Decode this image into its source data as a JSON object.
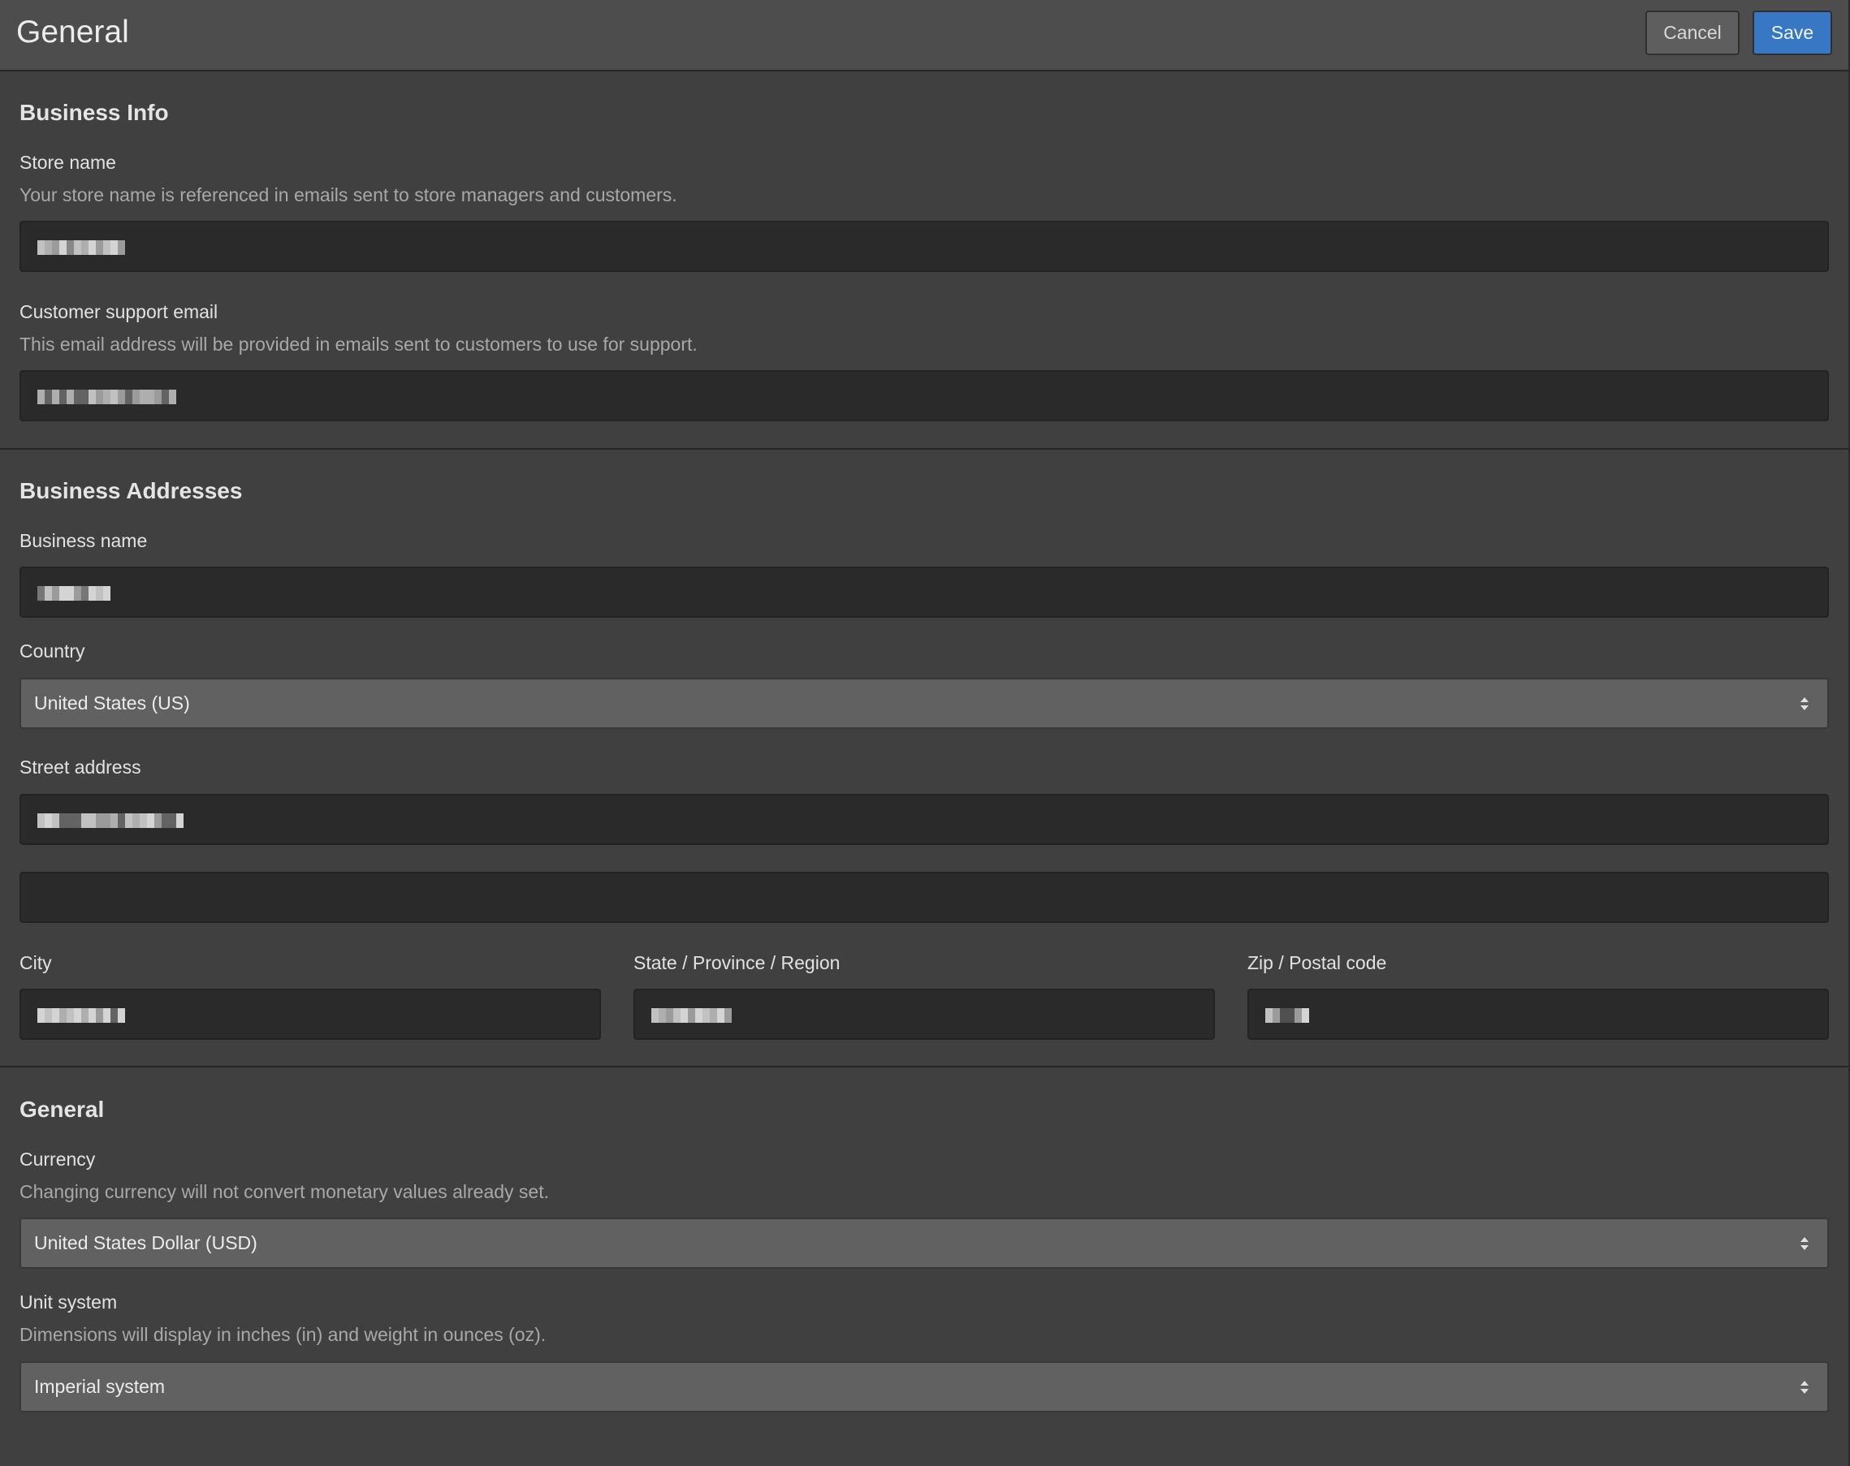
{
  "header": {
    "title": "General",
    "cancel_label": "Cancel",
    "save_label": "Save"
  },
  "colors": {
    "background": "#404040",
    "header_background": "#4d4d4d",
    "input_background": "#2a2a2a",
    "select_background": "#616161",
    "primary_button": "#3877c4",
    "secondary_button": "#5e5e5e"
  },
  "business_info": {
    "heading": "Business Info",
    "store_name": {
      "label": "Store name",
      "helper": "Your store name is referenced in emails sent to store managers and customers.",
      "value_redacted": true
    },
    "support_email": {
      "label": "Customer support email",
      "helper": "This email address will be provided in emails sent to customers to use for support.",
      "value_redacted": true
    }
  },
  "business_addresses": {
    "heading": "Business Addresses",
    "business_name": {
      "label": "Business name",
      "value_redacted": true
    },
    "country": {
      "label": "Country",
      "selected": "United States (US)"
    },
    "street_address": {
      "label": "Street address",
      "line1_redacted": true,
      "line2": ""
    },
    "city": {
      "label": "City",
      "value_redacted": true
    },
    "state": {
      "label": "State / Province / Region",
      "value_redacted": true
    },
    "zip": {
      "label": "Zip / Postal code",
      "value_redacted": true
    }
  },
  "general": {
    "heading": "General",
    "currency": {
      "label": "Currency",
      "helper": "Changing currency will not convert monetary values already set.",
      "selected": "United States Dollar (USD)"
    },
    "unit_system": {
      "label": "Unit system",
      "helper": "Dimensions will display in inches (in) and weight in ounces (oz).",
      "selected": "Imperial system"
    }
  },
  "icons": {
    "select_arrows": "sort-arrows-icon"
  }
}
